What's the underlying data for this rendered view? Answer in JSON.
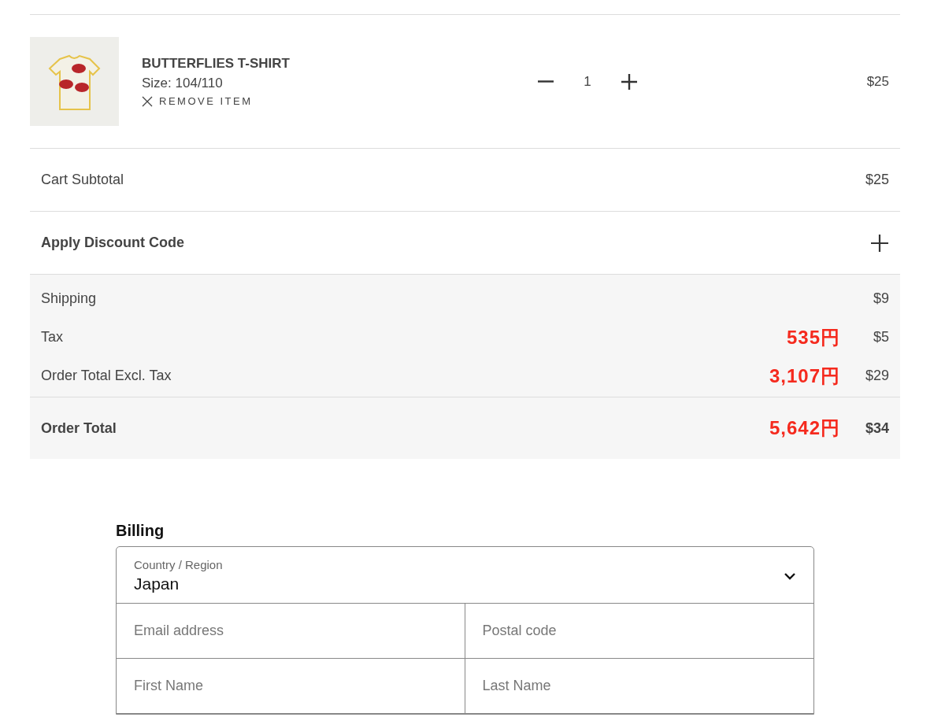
{
  "cart_item": {
    "name": "BUTTERFLIES T-SHIRT",
    "size": "Size: 104/110",
    "remove_label": "REMOVE ITEM",
    "quantity": "1",
    "price": "$25"
  },
  "subtotal": {
    "label": "Cart Subtotal",
    "value": "$25"
  },
  "discount": {
    "label": "Apply Discount Code",
    "expanded": false
  },
  "summary_rows": [
    {
      "kind": "plain",
      "label": "Shipping",
      "value": "$9"
    },
    {
      "kind": "plain",
      "label": "Tax",
      "yen_note": "535円",
      "value": "$5"
    },
    {
      "kind": "plain",
      "label": "Order Total Excl. Tax",
      "yen_note": "3,107円",
      "value": "$29"
    },
    {
      "kind": "total",
      "label": "Order Total",
      "yen_note": "5,642円",
      "value": "$34"
    }
  ],
  "billing": {
    "heading": "Billing",
    "country_label": "Country / Region",
    "country_value": "Japan",
    "fields": [
      {
        "placeholder": "Email address"
      },
      {
        "placeholder": "Postal code"
      },
      {
        "placeholder": "First Name"
      },
      {
        "placeholder": "Last Name"
      }
    ]
  }
}
